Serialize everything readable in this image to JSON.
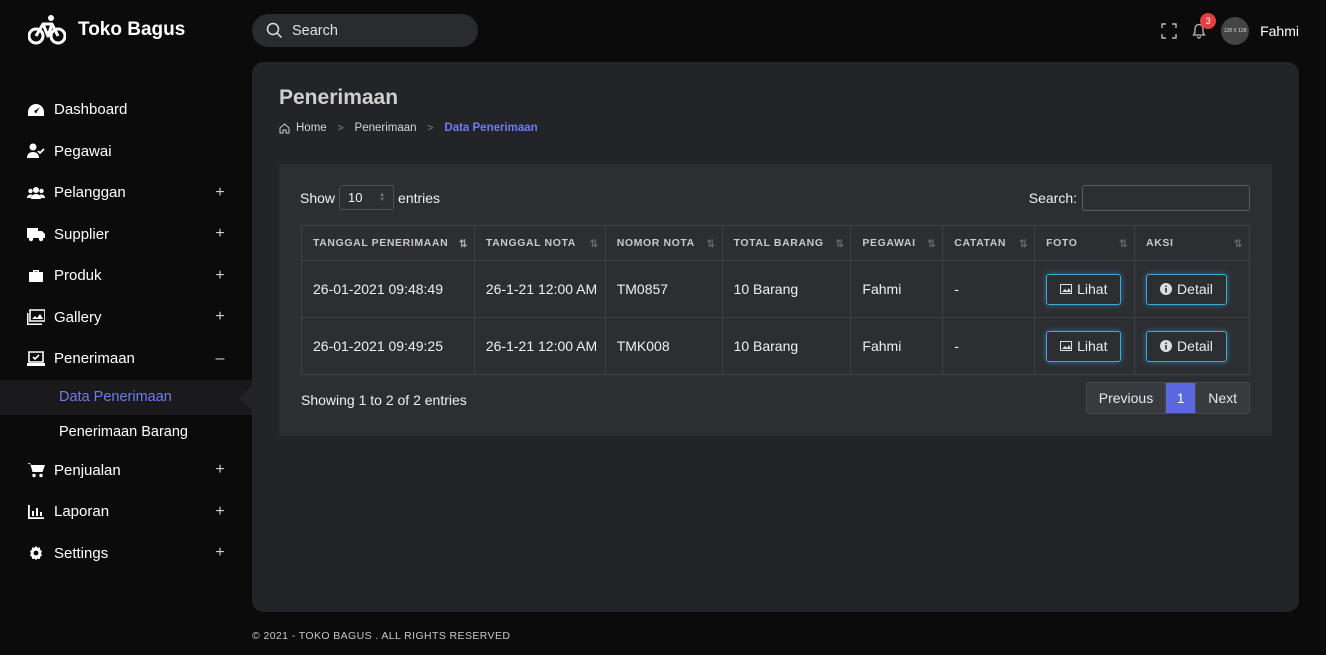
{
  "brand": {
    "name": "Toko Bagus",
    "logo_icon": "bicycle-icon"
  },
  "sidebar": {
    "items": [
      {
        "label": "Dashboard",
        "icon": "dashboard-icon",
        "toggle": ""
      },
      {
        "label": "Pegawai",
        "icon": "user-check-icon",
        "toggle": ""
      },
      {
        "label": "Pelanggan",
        "icon": "users-icon",
        "toggle": "+"
      },
      {
        "label": "Supplier",
        "icon": "truck-icon",
        "toggle": "+"
      },
      {
        "label": "Produk",
        "icon": "briefcase-icon",
        "toggle": "+"
      },
      {
        "label": "Gallery",
        "icon": "images-icon",
        "toggle": "+"
      },
      {
        "label": "Penerimaan",
        "icon": "inbox-icon",
        "toggle": "–"
      },
      {
        "label": "Penjualan",
        "icon": "cart-icon",
        "toggle": "+"
      },
      {
        "label": "Laporan",
        "icon": "chart-icon",
        "toggle": "+"
      },
      {
        "label": "Settings",
        "icon": "gear-icon",
        "toggle": "+"
      }
    ],
    "sub_items": [
      {
        "label": "Data Penerimaan",
        "active": true
      },
      {
        "label": "Penerimaan Barang",
        "active": false
      }
    ]
  },
  "header": {
    "search_placeholder": "Search",
    "notification_count": "3",
    "avatar_text": "128 X 128",
    "user_name": "Fahmi"
  },
  "page": {
    "title": "Penerimaan",
    "breadcrumb": [
      "Home",
      "Penerimaan",
      "Data Penerimaan"
    ]
  },
  "table_controls": {
    "show_label": "Show",
    "page_length": "10",
    "entries_label": "entries",
    "search_label": "Search:"
  },
  "table": {
    "columns": [
      "TANGGAL PENERIMAAN",
      "TANGGAL NOTA",
      "NOMOR NOTA",
      "TOTAL BARANG",
      "PEGAWAI",
      "CATATAN",
      "FOTO",
      "AKSI"
    ],
    "rows": [
      {
        "tanggal_penerimaan": "26-01-2021 09:48:49",
        "tanggal_nota": "26-1-21 12:00 AM",
        "nomor_nota": "TM0857",
        "total_barang": "10 Barang",
        "pegawai": "Fahmi",
        "catatan": "-",
        "foto_button": "Lihat",
        "aksi_button": "Detail"
      },
      {
        "tanggal_penerimaan": "26-01-2021 09:49:25",
        "tanggal_nota": "26-1-21 12:00 AM",
        "nomor_nota": "TMK008",
        "total_barang": "10 Barang",
        "pegawai": "Fahmi",
        "catatan": "-",
        "foto_button": "Lihat",
        "aksi_button": "Detail"
      }
    ]
  },
  "pagination": {
    "info": "Showing 1 to 2 of 2 entries",
    "previous": "Previous",
    "current": "1",
    "next": "Next"
  },
  "footer": {
    "text": "© 2021 - TOKO BAGUS . ALL RIGHTS RESERVED"
  },
  "colors": {
    "accent": "#6f7cf0",
    "button_border": "#3aa8d8",
    "badge": "#e53e3e",
    "card": "#232427"
  }
}
